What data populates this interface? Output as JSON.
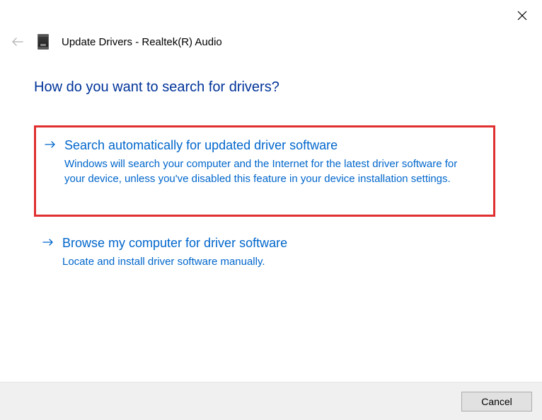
{
  "window": {
    "title": "Update Drivers - Realtek(R) Audio"
  },
  "heading": "How do you want to search for drivers?",
  "options": [
    {
      "title": "Search automatically for updated driver software",
      "description": "Windows will search your computer and the Internet for the latest driver software for your device, unless you've disabled this feature in your device installation settings.",
      "highlighted": true
    },
    {
      "title": "Browse my computer for driver software",
      "description": "Locate and install driver software manually.",
      "highlighted": false
    }
  ],
  "buttons": {
    "cancel": "Cancel"
  }
}
